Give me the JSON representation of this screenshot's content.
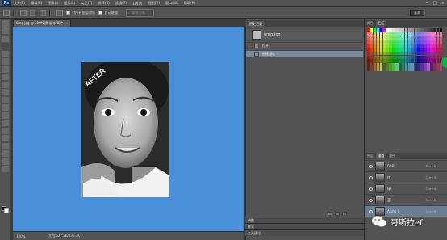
{
  "app": {
    "logo": "Ps"
  },
  "menubar": {
    "items": [
      "文件(F)",
      "编辑(E)",
      "图像(I)",
      "图层(L)",
      "类型(Y)",
      "选择(S)",
      "滤镜(T)",
      "3D(D)",
      "视图(V)",
      "窗口(W)",
      "帮助(H)"
    ],
    "window_controls": [
      "–",
      "□",
      "×"
    ]
  },
  "options_bar": {
    "checkbox_1_label": "对所有图层取样",
    "checkbox_2_label": "自动增强",
    "refine_button": "调整边缘...",
    "workspace": "基本"
  },
  "document": {
    "tab_title": "6mg.jpg @ 100%(黑 副本/8) *",
    "tab_close": "×",
    "canvas_color": "#4a90d9",
    "photo_badge": "AFTER",
    "zoom": "100%",
    "info": "文档:527.2K/936.7K"
  },
  "history_panel": {
    "tab": "历史记录",
    "snapshot_name": "6mg.jpg",
    "rows": [
      "打开",
      "新建通道"
    ]
  },
  "collapsed_panels": [
    "调整",
    "样式",
    "工具预设"
  ],
  "swatches_panel": {
    "tabs": [
      "颜色",
      "色板"
    ]
  },
  "channels_panel": {
    "tabs": [
      "图层",
      "通道",
      "路径"
    ],
    "rows": [
      {
        "name": "RGB",
        "shortcut": "Ctrl+2"
      },
      {
        "name": "红",
        "shortcut": "Ctrl+3"
      },
      {
        "name": "绿",
        "shortcut": "Ctrl+4"
      },
      {
        "name": "蓝",
        "shortcut": "Ctrl+5"
      },
      {
        "name": "Alpha 1",
        "shortcut": "Ctrl+6"
      }
    ]
  },
  "watermark": {
    "text": "哥斯拉ef"
  }
}
